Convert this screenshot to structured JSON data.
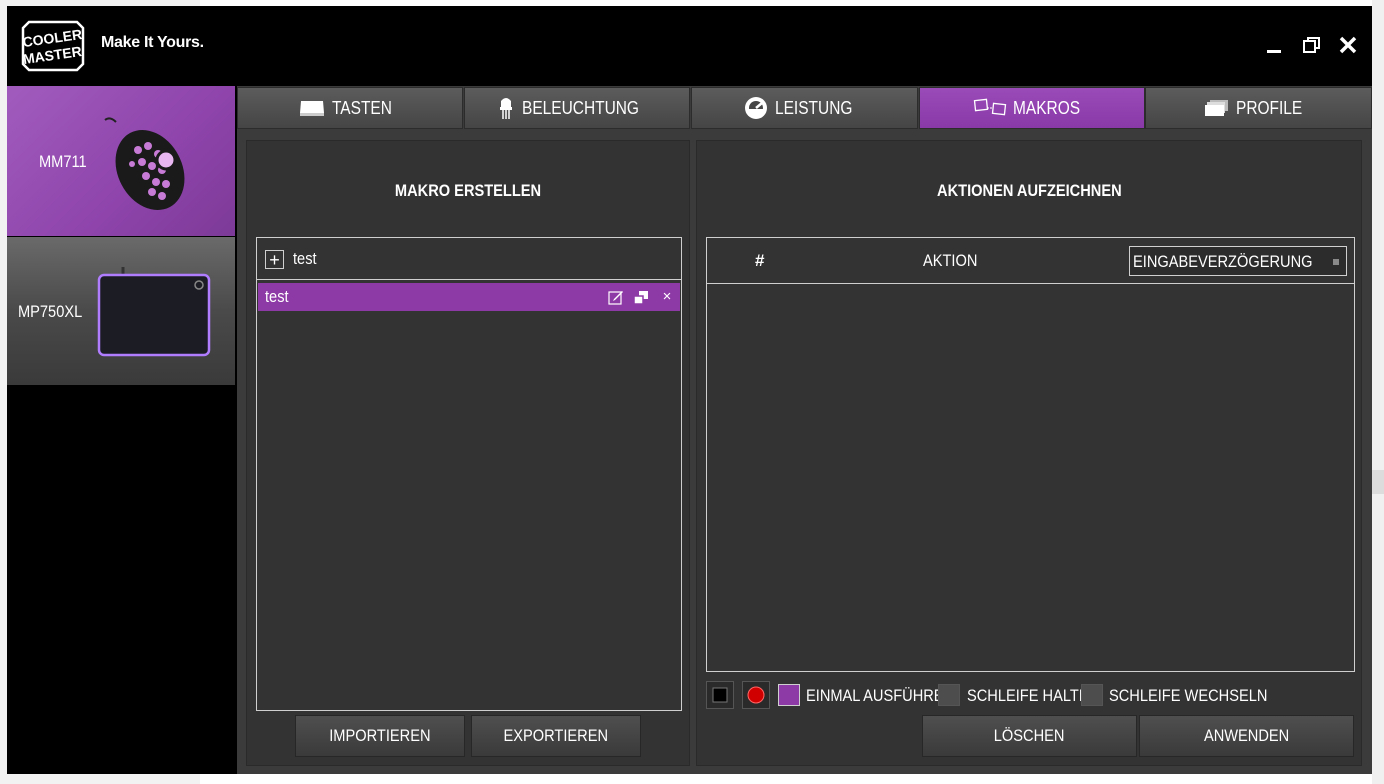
{
  "header": {
    "logo_text": "COOLER MASTER",
    "slogan": "Make It Yours.",
    "window_controls": {
      "minimize_icon": "minimize-icon",
      "maximize_icon": "restore-icon",
      "close_icon": "close-icon"
    }
  },
  "sidebar": {
    "devices": [
      {
        "name": "MM711",
        "active": true,
        "image": "mouse-image"
      },
      {
        "name": "MP750XL",
        "active": false,
        "image": "mousepad-image"
      }
    ]
  },
  "tabs": [
    {
      "label": "TASTEN",
      "icon": "keys-icon",
      "active": false
    },
    {
      "label": "BELEUCHTUNG",
      "icon": "light-icon",
      "active": false
    },
    {
      "label": "LEISTUNG",
      "icon": "performance-icon",
      "active": false
    },
    {
      "label": "MAKROS",
      "icon": "macro-icon",
      "active": true
    },
    {
      "label": "PROFILE",
      "icon": "profile-icon",
      "active": false
    }
  ],
  "macro_panel": {
    "title": "MAKRO ERSTELLEN",
    "new_macro_name": "test",
    "macros": [
      {
        "name": "test",
        "selected": true
      }
    ],
    "import_label": "IMPORTIEREN",
    "export_label": "EXPORTIEREN"
  },
  "record_panel": {
    "title": "AKTIONEN AUFZEICHNEN",
    "columns": {
      "number": "#",
      "action": "AKTION"
    },
    "delay_select": "EINGABEVERZÖGERUNG",
    "actions": [],
    "modes": [
      {
        "label": "EINMAL AUSFÜHREN",
        "checked": true
      },
      {
        "label": "SCHLEIFE HALTEN",
        "checked": false
      },
      {
        "label": "SCHLEIFE WECHSELN",
        "checked": false
      }
    ],
    "clear_label": "LÖSCHEN",
    "apply_label": "ANWENDEN"
  },
  "colors": {
    "accent": "#8e3aa6",
    "background": "#000000",
    "panel": "#333333",
    "tab": "#4f4f4f"
  }
}
